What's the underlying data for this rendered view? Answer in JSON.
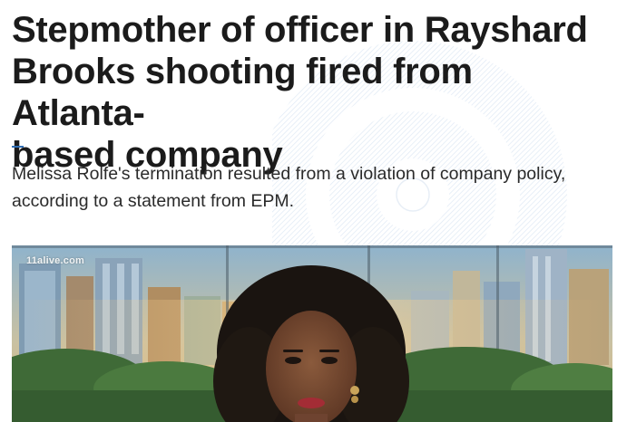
{
  "article": {
    "headline": "Stepmother of officer in Rayshard\nBrooks shooting fired from Atlanta-\nbased company",
    "dek": "Melissa Rolfe's termination resulted from a violation of company policy,\naccording to a statement from EPM."
  },
  "video": {
    "source_tag": "11alive.com"
  },
  "colors": {
    "accent": "#2f6eb5",
    "headline": "#1b1b1b",
    "watermark": "#dfe9f4"
  },
  "icons": {
    "watermark": "concentric-circles-icon"
  }
}
